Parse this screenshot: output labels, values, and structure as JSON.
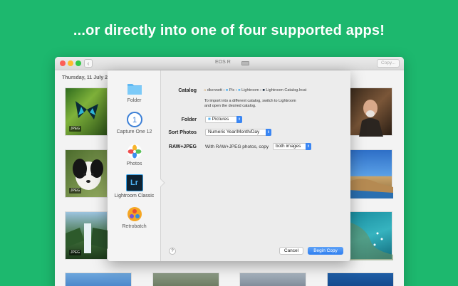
{
  "headline": "...or directly into one of four supported apps!",
  "window": {
    "title": "EOS R",
    "copy_button": "Copy...",
    "date_label": "Thursday, 11 July 2"
  },
  "thumbnails": [
    {
      "badge": "JPEG"
    },
    {
      "badge": "JPEG"
    },
    {
      "badge": "JPEG"
    }
  ],
  "apps": [
    {
      "label": "Folder",
      "icon": "folder-icon"
    },
    {
      "label": "Capture One 12",
      "icon": "capture-one-icon"
    },
    {
      "label": "Photos",
      "icon": "photos-icon"
    },
    {
      "label": "Lightroom Classic",
      "icon": "lightroom-icon",
      "icon_text": "Lr",
      "selected": true
    },
    {
      "label": "Retrobatch",
      "icon": "retrobatch-icon"
    }
  ],
  "form": {
    "catalog_label": "Catalog",
    "catalog_path": [
      {
        "text": "dkennett"
      },
      {
        "text": "Pic"
      },
      {
        "text": "Lightroom"
      },
      {
        "text": "Lightroom Catalog.lrcat"
      }
    ],
    "catalog_hint_line1": "To import into a different catalog, switch to Lightroom",
    "catalog_hint_line2": "and open the desired catalog.",
    "folder_label": "Folder",
    "folder_value": "Pictures",
    "sort_label": "Sort Photos",
    "sort_value": "Numeric Year/Month/Day",
    "raw_label": "RAW+JPEG",
    "raw_text": "With RAW+JPEG photos, copy",
    "raw_value": "both images"
  },
  "buttons": {
    "help": "?",
    "cancel": "Cancel",
    "begin": "Begin Copy"
  },
  "colors": {
    "background": "#1db86e",
    "accent": "#2e7ef0"
  }
}
